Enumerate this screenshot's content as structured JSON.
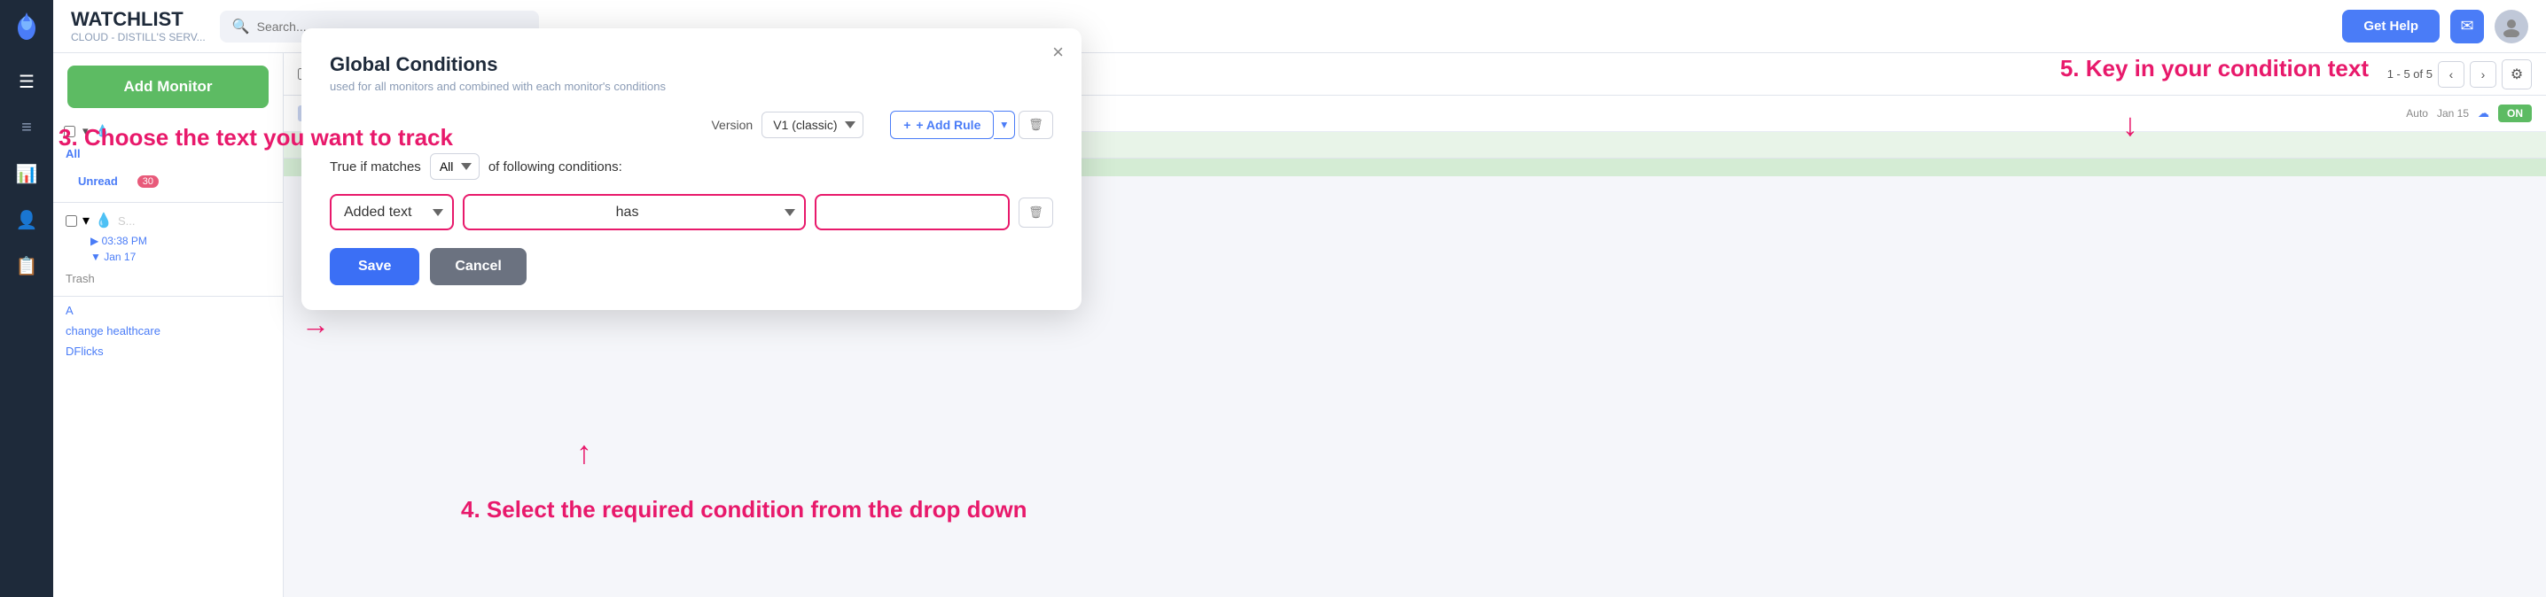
{
  "sidebar": {
    "logo_alt": "Distill logo",
    "items": [
      {
        "id": "home",
        "icon": "💧",
        "label": "Home",
        "active": true
      },
      {
        "id": "menu",
        "icon": "☰",
        "label": "Menu"
      },
      {
        "id": "chart",
        "icon": "📊",
        "label": "Charts"
      },
      {
        "id": "users",
        "icon": "👤",
        "label": "Users"
      },
      {
        "id": "docs",
        "icon": "📋",
        "label": "Documents"
      }
    ]
  },
  "header": {
    "title": "WATCHLIST",
    "subtitle": "CLOUD - DISTILL'S SERV...",
    "search_placeholder": "Search...",
    "get_help_label": "Get Help"
  },
  "left_panel": {
    "add_monitor_label": "Add Monitor",
    "filters": [
      {
        "id": "all",
        "label": "All"
      },
      {
        "id": "unread",
        "label": "Unread",
        "badge": "30"
      },
      {
        "id": "trash",
        "label": "Trash"
      },
      {
        "id": "a",
        "label": "A"
      },
      {
        "id": "change_healthcare",
        "label": "change healthcare"
      },
      {
        "id": "dflicks",
        "label": "DFlicks"
      }
    ]
  },
  "table_header": {
    "pagination": "1 - 5 of 5",
    "prev_label": "‹",
    "next_label": "›"
  },
  "modal": {
    "title": "Global Conditions",
    "subtitle": "used for all monitors and combined with each monitor's conditions",
    "close_label": "×",
    "version_label": "Version",
    "version_value": "V1 (classic)",
    "true_if_matches_label": "True if matches",
    "match_value": "All",
    "of_following_label": "of following conditions:",
    "add_rule_label": "+ Add Rule",
    "condition_type": "Added text",
    "condition_op": "has",
    "condition_value": "",
    "save_label": "Save",
    "cancel_label": "Cancel"
  },
  "annotations": {
    "step3": "3. Choose the text you want to track",
    "step4": "4. Select the required condition from the drop down",
    "step5": "5. Key in your condition text"
  },
  "monitor_rows": [
    {
      "time": "03:38 PM",
      "date": "Jan 17",
      "status": "ON"
    },
    {
      "time": "",
      "date": "Jan 15",
      "status": "ON"
    }
  ]
}
